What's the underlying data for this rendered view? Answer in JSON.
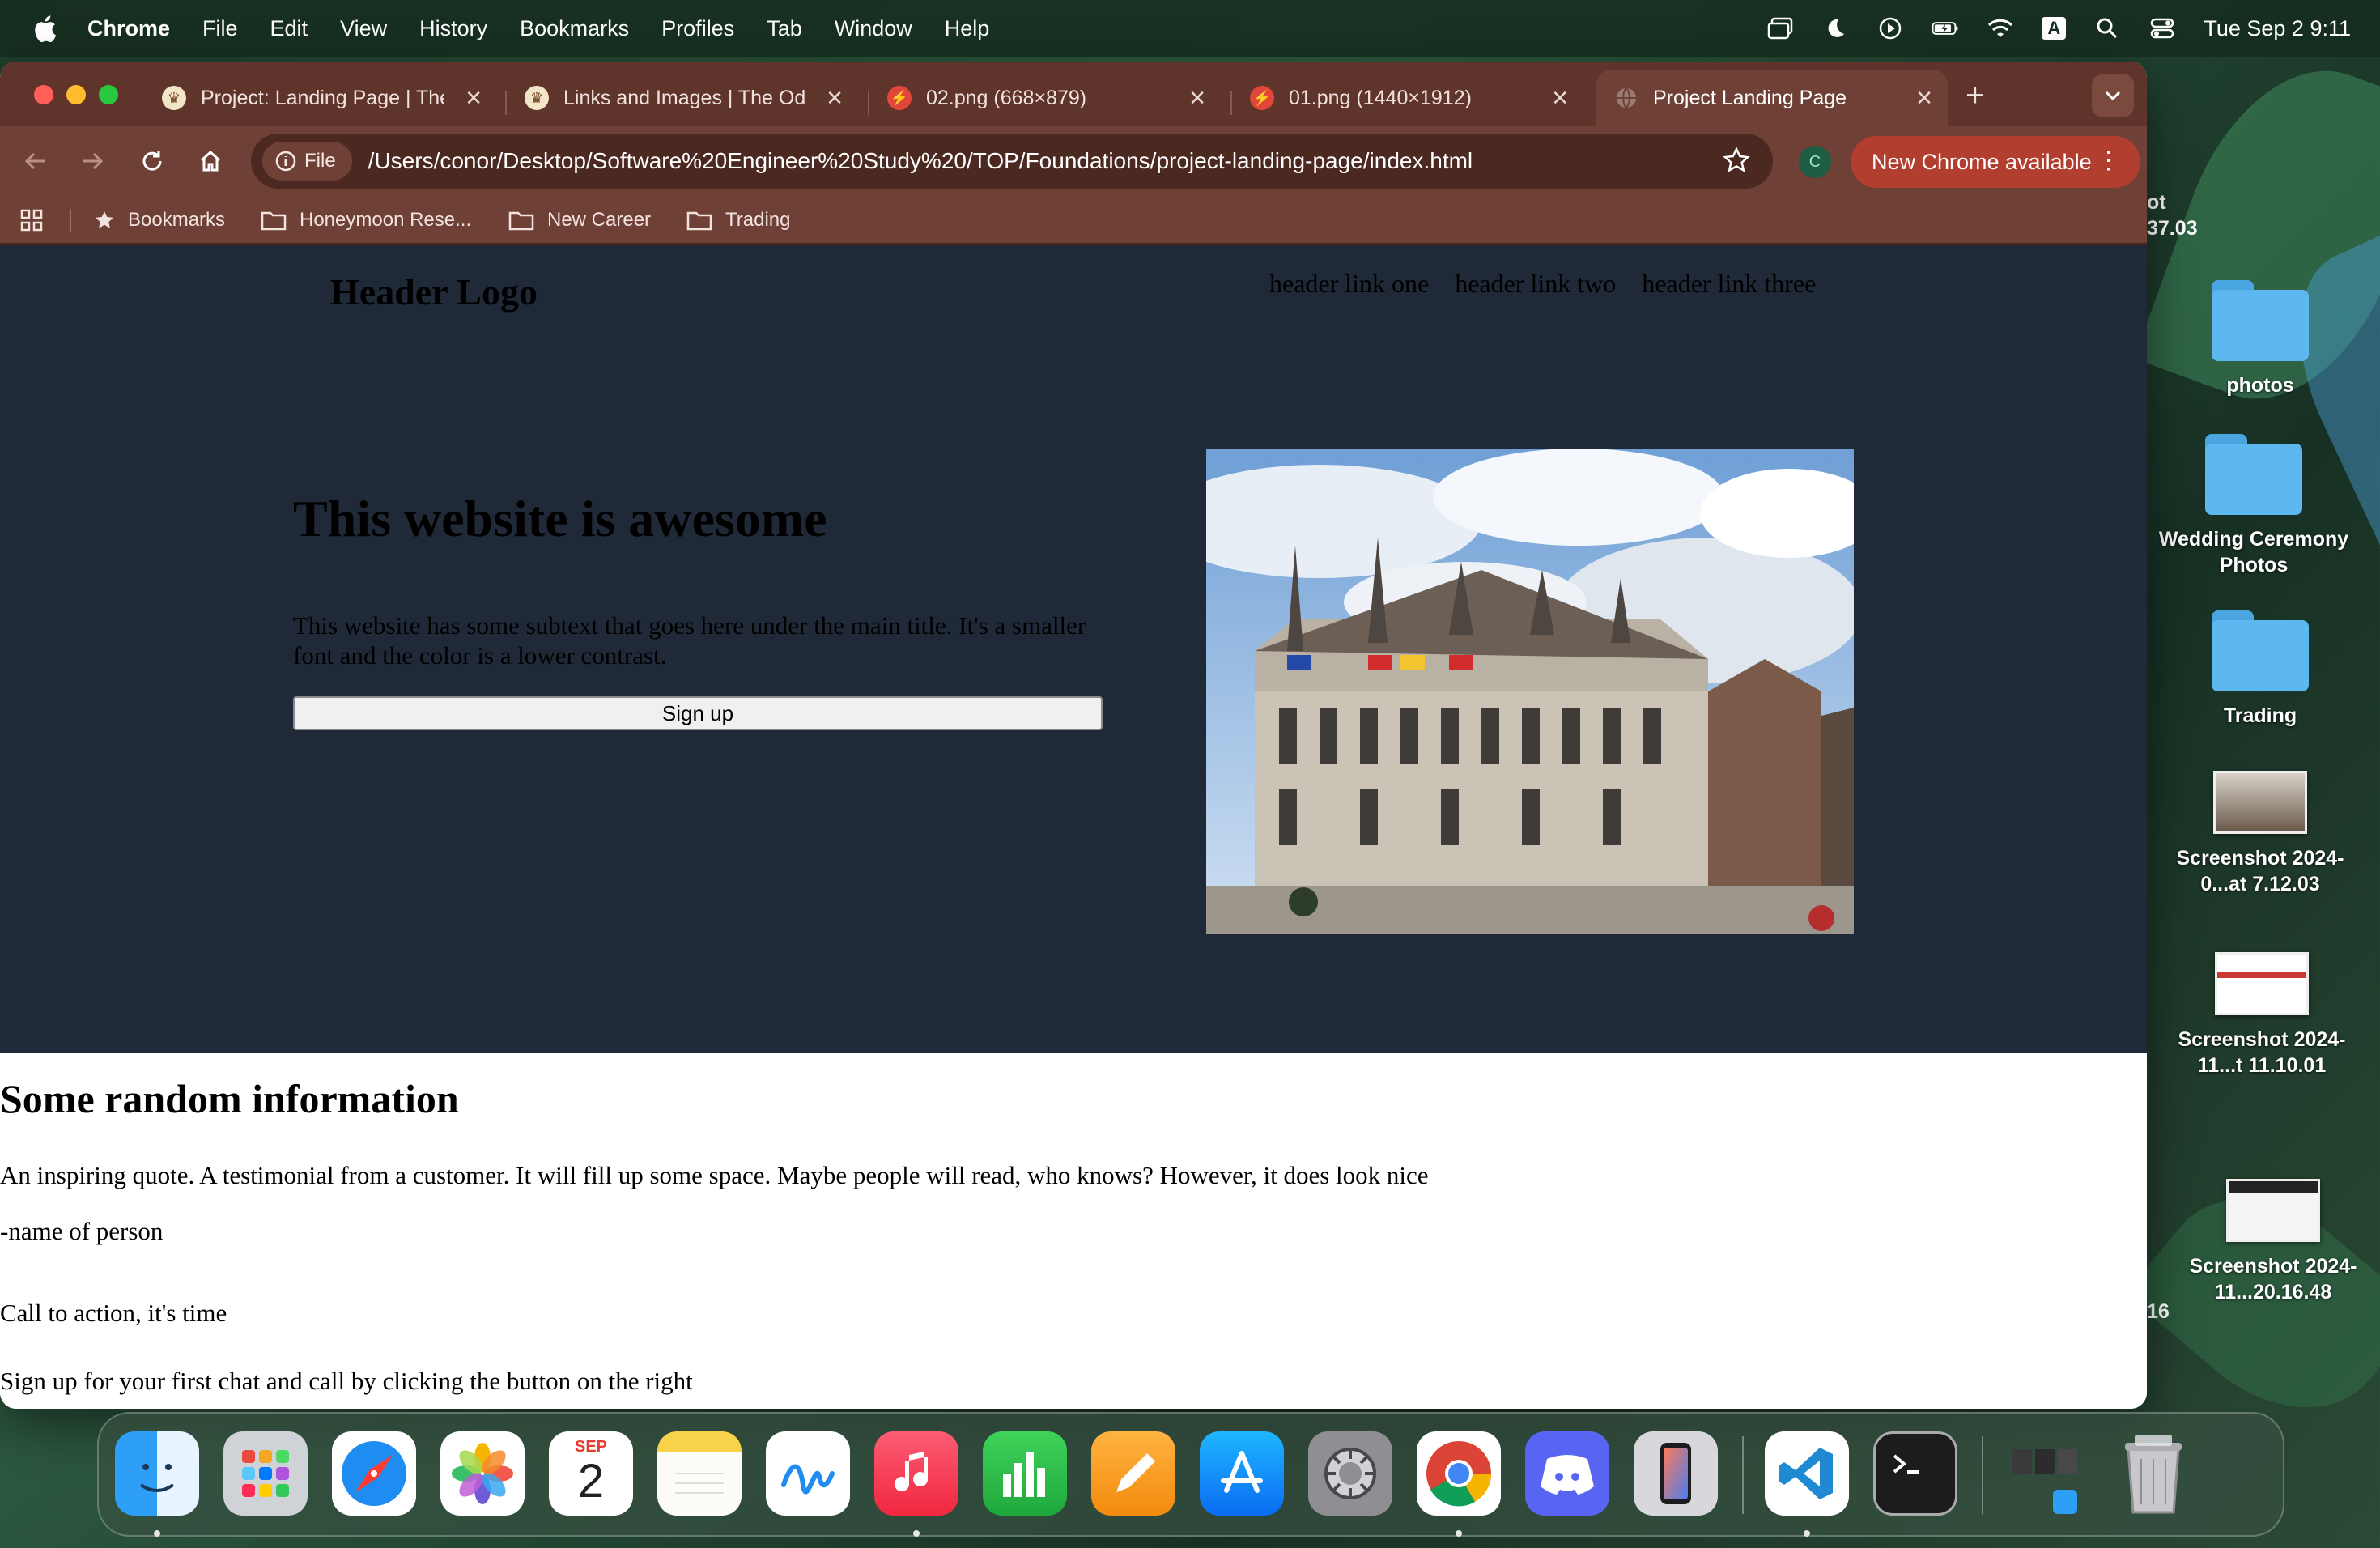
{
  "menubar": {
    "app_name": "Chrome",
    "items": [
      "File",
      "Edit",
      "View",
      "History",
      "Bookmarks",
      "Profiles",
      "Tab",
      "Window",
      "Help"
    ],
    "clock": "Tue Sep 2  9:11",
    "input_source": "A"
  },
  "tabs": [
    {
      "title": "Project: Landing Page | The Odin Project",
      "icon": "odin-icon",
      "active": false
    },
    {
      "title": "Links and Images | The Odin Project",
      "icon": "odin-icon",
      "active": false
    },
    {
      "title": "02.png (668×879)",
      "icon": "image-viewer-icon",
      "active": false
    },
    {
      "title": "01.png (1440×1912)",
      "icon": "image-viewer-icon",
      "active": false
    },
    {
      "title": "Project Landing Page",
      "icon": "globe-icon",
      "active": true
    }
  ],
  "toolbar": {
    "scheme_chip": "File",
    "url": "/Users/conor/Desktop/Software%20Engineer%20Study%20/TOP/Foundations/project-landing-page/index.html",
    "profile_initial": "C",
    "update_label": "New Chrome available"
  },
  "bookmarks_bar": {
    "items": [
      "Bookmarks",
      "Honeymoon Rese...",
      "New Career",
      "Trading"
    ]
  },
  "page": {
    "logo": "Header Logo",
    "nav_links": [
      "header link one",
      "header link two",
      "header link three"
    ],
    "hero_title": "This website is awesome",
    "hero_subtext": "This website has some subtext that goes here under the main title. It's a smaller font and the color is a lower contrast.",
    "signup_label": "Sign up",
    "info_title": "Some random information",
    "quote": "An inspiring quote. A testimonial from a customer. It will fill up some space. Maybe people will read, who knows? However, it does look nice",
    "quote_author": "-name of person",
    "cta_title": "Call to action, it's time",
    "cta_text": "Sign up for your first chat and call by clicking the button on the right"
  },
  "desktop": {
    "partial_labels": [
      "ot",
      "37.03",
      "16"
    ],
    "items": [
      {
        "label": "photos",
        "kind": "folder"
      },
      {
        "label": "Wedding Ceremony Photos",
        "kind": "folder"
      },
      {
        "label": "Trading",
        "kind": "folder"
      },
      {
        "label": "Screenshot 2024-0...at 7.12.03",
        "kind": "screenshot"
      },
      {
        "label": "Screenshot 2024-11...t 11.10.01",
        "kind": "screenshot"
      },
      {
        "label": "Screenshot 2024-11...20.16.48",
        "kind": "screenshot"
      }
    ]
  },
  "dock": {
    "apps": [
      "Finder",
      "Launchpad",
      "Safari",
      "Photos",
      "Calendar",
      "Notes",
      "Freeform",
      "Music",
      "Numbers",
      "Pages",
      "App Store",
      "System Settings",
      "Google Chrome",
      "Discord",
      "iPhone Mirroring",
      "Visual Studio Code",
      "Terminal"
    ],
    "calendar_month": "SEP",
    "calendar_day": "2"
  },
  "colors": {
    "tab_strip": "#5e342b",
    "toolbar": "#6f4035",
    "hero_bg": "#1f2937",
    "update_button": "#b13e2f"
  }
}
